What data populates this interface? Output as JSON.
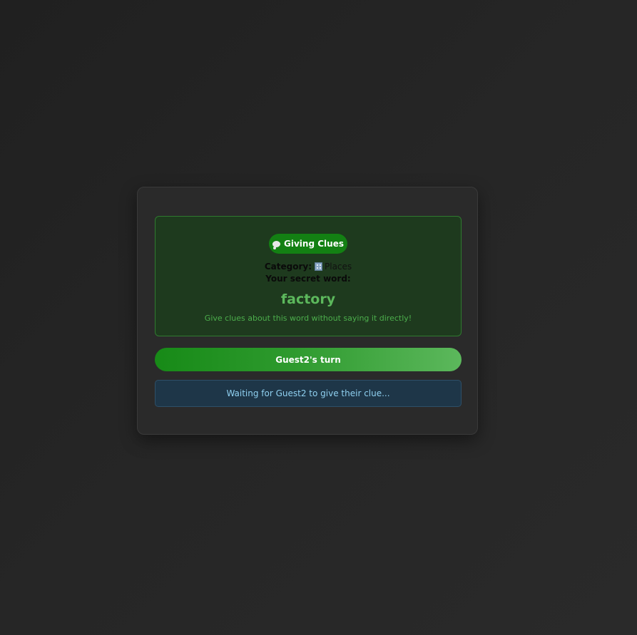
{
  "game": {
    "phase_label": "Giving Clues",
    "phase_icon": "speech-bubble-icon",
    "category_label": "Category:",
    "category_icon": "office-building-icon",
    "category_value": "Places",
    "secret_label": "Your secret word:",
    "secret_word": "factory",
    "hint": "Give clues about this word without saying it directly!"
  },
  "turn": {
    "label": "Guest2's turn"
  },
  "status": {
    "message": "Waiting for Guest2 to give their clue..."
  },
  "colors": {
    "accent_green": "#138013",
    "secret_word": "#5cb85c",
    "info_text": "#8fd0f0"
  }
}
